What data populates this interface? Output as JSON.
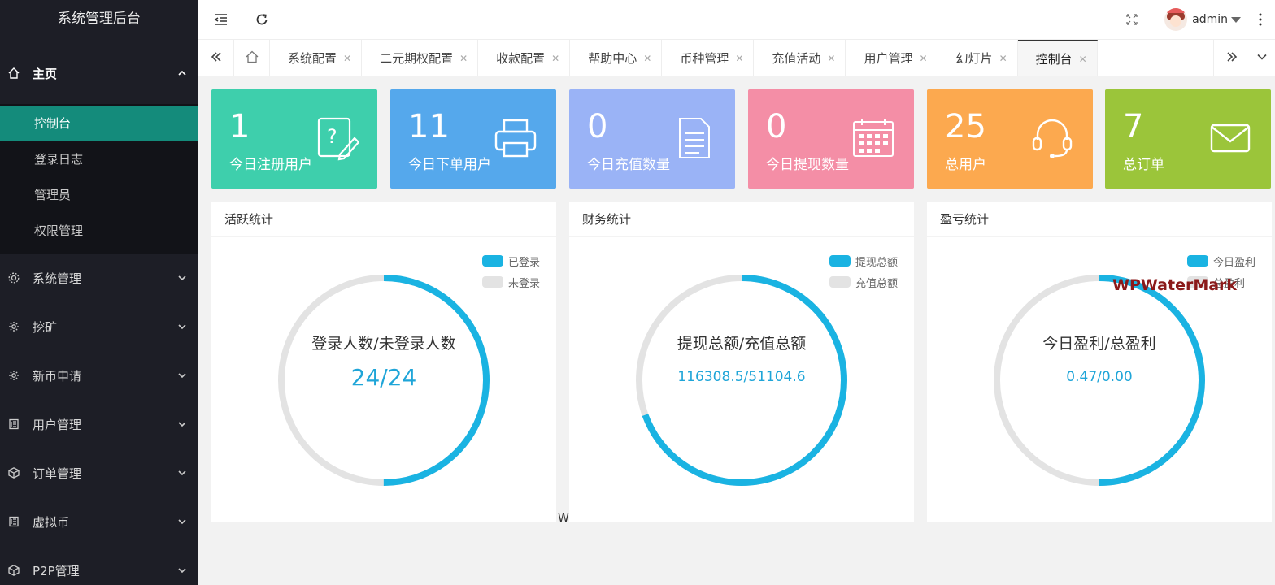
{
  "app": {
    "title": "系统管理后台"
  },
  "sidebar": {
    "home": {
      "label": "主页",
      "icon": "home-icon",
      "expanded": true
    },
    "home_items": [
      {
        "label": "控制台",
        "active": true
      },
      {
        "label": "登录日志"
      },
      {
        "label": "管理员"
      },
      {
        "label": "权限管理"
      }
    ],
    "groups": [
      {
        "label": "系统管理",
        "icon": "gear-icon"
      },
      {
        "label": "挖矿",
        "icon": "cog-icon"
      },
      {
        "label": "新币申请",
        "icon": "cog-icon"
      },
      {
        "label": "用户管理",
        "icon": "list-icon"
      },
      {
        "label": "订单管理",
        "icon": "cube-icon"
      },
      {
        "label": "虚拟币",
        "icon": "list-icon"
      },
      {
        "label": "P2P管理",
        "icon": "cube-icon"
      }
    ]
  },
  "header": {
    "user": "admin",
    "icons": [
      "menu-fold-icon",
      "refresh-icon",
      "fullscreen-icon",
      "more-icon"
    ]
  },
  "tabs": [
    {
      "label": "系统配置"
    },
    {
      "label": "二元期权配置"
    },
    {
      "label": "收款配置"
    },
    {
      "label": "帮助中心"
    },
    {
      "label": "币种管理"
    },
    {
      "label": "充值活动"
    },
    {
      "label": "用户管理"
    },
    {
      "label": "幻灯片"
    },
    {
      "label": "控制台",
      "active": true
    }
  ],
  "stats": [
    {
      "value": "1",
      "label": "今日注册用户",
      "color": "#3ecfac",
      "icon": "question-edit-icon"
    },
    {
      "value": "11",
      "label": "今日下单用户",
      "color": "#55a8ec",
      "icon": "printer-icon"
    },
    {
      "value": "0",
      "label": "今日充值数量",
      "color": "#9ab3f6",
      "icon": "document-icon"
    },
    {
      "value": "0",
      "label": "今日提现数量",
      "color": "#f48ea6",
      "icon": "calendar-icon"
    },
    {
      "value": "25",
      "label": "总用户",
      "color": "#fca94f",
      "icon": "headset-icon"
    },
    {
      "value": "7",
      "label": "总订单",
      "color": "#9bc53a",
      "icon": "mail-icon"
    }
  ],
  "colors": {
    "primary_series": "#1ab3e2",
    "secondary_series": "#e3e3e3",
    "active_nav": "#148b7b"
  },
  "panels": [
    {
      "title": "活跃统计",
      "legend": [
        "已登录",
        "未登录"
      ],
      "center_title": "登录人数/未登录人数",
      "center_value": "24/24",
      "big": true
    },
    {
      "title": "财务统计",
      "legend": [
        "提现总额",
        "充值总额"
      ],
      "center_title": "提现总额/充值总额",
      "center_value": "116308.5/51104.6",
      "big": false
    },
    {
      "title": "盈亏统计",
      "legend": [
        "今日盈利",
        "总盈利"
      ],
      "center_title": "今日盈利/总盈利",
      "center_value": "0.47/0.00",
      "big": false
    }
  ],
  "chart_data": [
    {
      "type": "pie",
      "categories": [
        "已登录",
        "未登录"
      ],
      "values": [
        24,
        24
      ]
    },
    {
      "type": "pie",
      "categories": [
        "提现总额",
        "充值总额"
      ],
      "values": [
        116308.5,
        51104.6
      ]
    },
    {
      "type": "pie",
      "categories": [
        "今日盈利",
        "总盈利"
      ],
      "values": [
        0.47,
        0.0
      ]
    }
  ],
  "watermark": "WPWaterMark",
  "watermark_small": "W"
}
